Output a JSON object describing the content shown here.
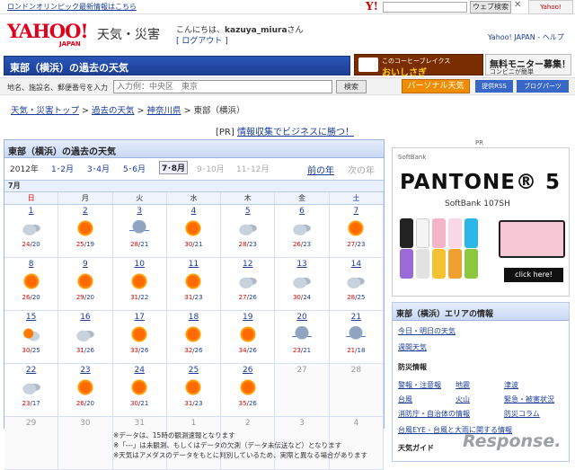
{
  "topbar": {
    "olympic_link": "ロンドンオリンピック最新情報はこちら",
    "yahoo_mini": "Y!",
    "search_button": "ウェブ検索",
    "close": "✕",
    "badge": "Yahoo!"
  },
  "header": {
    "logo": "YAHOO!",
    "logo_sub": "JAPAN",
    "service": "天気・災害",
    "greeting_prefix": "こんにちは、",
    "username": "kazuya_miura",
    "greeting_suffix": "さん",
    "logout": "[ ログアウト ]",
    "links": "Yahoo! JAPAN - ヘルプ"
  },
  "bluebar": {
    "title": "東部（横浜）の過去の天気"
  },
  "ads": {
    "coffee_line1": "このコーヒーブレイクス",
    "coffee_line2": "おいしさぎ",
    "monitor_line1": "無料モニター募集！",
    "monitor_line2": "コンビニが簡単"
  },
  "searchrow": {
    "label": "地名、施設名、郵便番号を入力",
    "placeholder": "入力例：中央区　東京",
    "button": "検索",
    "personal": "パーソナル天気",
    "rss": "提供RSS",
    "blog": "ブログパーツ"
  },
  "breadcrumb": {
    "items": [
      "天気・災害トップ",
      "過去の天気",
      "神奈川県"
    ],
    "current": "東部（横浜）",
    "sep": " > "
  },
  "pr": {
    "tag": "[PR]",
    "link": "情報収集でビジネスに勝つ！"
  },
  "main": {
    "title": "東部（横浜）の過去の天気",
    "year": "2012年",
    "months": [
      {
        "label": "1･2月",
        "state": "link"
      },
      {
        "label": "3･4月",
        "state": "link"
      },
      {
        "label": "5･6月",
        "state": "link"
      },
      {
        "label": "7･8月",
        "state": "selected"
      },
      {
        "label": "9･10月",
        "state": "disabled"
      },
      {
        "label": "11･12月",
        "state": "disabled"
      }
    ],
    "prev_year": "前の年",
    "next_year": "次の年",
    "calendar_month": "7月",
    "weekdays": [
      "日",
      "月",
      "火",
      "水",
      "木",
      "金",
      "土"
    ],
    "weeks": [
      [
        {
          "day": "1",
          "icon": "cloudy",
          "hi": "24",
          "lo": "20"
        },
        {
          "day": "2",
          "icon": "sunny",
          "hi": "25",
          "lo": "19"
        },
        {
          "day": "3",
          "icon": "rain",
          "hi": "28",
          "lo": "21"
        },
        {
          "day": "4",
          "icon": "sunny",
          "hi": "30",
          "lo": "21"
        },
        {
          "day": "5",
          "icon": "cloudy",
          "hi": "28",
          "lo": "23"
        },
        {
          "day": "6",
          "icon": "cloudy",
          "hi": "26",
          "lo": "23"
        },
        {
          "day": "7",
          "icon": "sunny",
          "hi": "27",
          "lo": "23"
        }
      ],
      [
        {
          "day": "8",
          "icon": "sunny",
          "hi": "26",
          "lo": "20"
        },
        {
          "day": "9",
          "icon": "sunny",
          "hi": "29",
          "lo": "20"
        },
        {
          "day": "10",
          "icon": "sunny",
          "hi": "31",
          "lo": "22"
        },
        {
          "day": "11",
          "icon": "sunny",
          "hi": "31",
          "lo": "23"
        },
        {
          "day": "12",
          "icon": "cloudy",
          "hi": "27",
          "lo": "26"
        },
        {
          "day": "13",
          "icon": "cloudy",
          "hi": "30",
          "lo": "24"
        },
        {
          "day": "14",
          "icon": "cloudy",
          "hi": "28",
          "lo": "25"
        }
      ],
      [
        {
          "day": "15",
          "icon": "sunnycloud",
          "hi": "30",
          "lo": "25"
        },
        {
          "day": "16",
          "icon": "cloudy",
          "hi": "31",
          "lo": "26"
        },
        {
          "day": "17",
          "icon": "sunny",
          "hi": "33",
          "lo": "26"
        },
        {
          "day": "18",
          "icon": "sunny",
          "hi": "32",
          "lo": "26"
        },
        {
          "day": "19",
          "icon": "sunny",
          "hi": "34",
          "lo": "26"
        },
        {
          "day": "20",
          "icon": "rain",
          "hi": "23",
          "lo": "21"
        },
        {
          "day": "21",
          "icon": "rain",
          "hi": "21",
          "lo": "18"
        }
      ],
      [
        {
          "day": "22",
          "icon": "cloudy",
          "hi": "23",
          "lo": "17"
        },
        {
          "day": "23",
          "icon": "sunny",
          "hi": "26",
          "lo": "20"
        },
        {
          "day": "24",
          "icon": "sunny",
          "hi": "30",
          "lo": "21"
        },
        {
          "day": "25",
          "icon": "sunny",
          "hi": "31",
          "lo": "23"
        },
        {
          "day": "26",
          "icon": "sunny",
          "hi": "35",
          "lo": "26"
        },
        {
          "day": "27",
          "icon": "",
          "hi": "",
          "lo": ""
        },
        {
          "day": "28",
          "icon": "",
          "hi": "",
          "lo": ""
        }
      ],
      [
        {
          "day": "29",
          "icon": "",
          "hi": "",
          "lo": ""
        },
        {
          "day": "30",
          "icon": "",
          "hi": "",
          "lo": ""
        },
        {
          "day": "31",
          "icon": "",
          "hi": "",
          "lo": ""
        },
        {
          "day": "1",
          "icon": "",
          "hi": "",
          "lo": ""
        },
        {
          "day": "2",
          "icon": "",
          "hi": "",
          "lo": ""
        },
        {
          "day": "3",
          "icon": "",
          "hi": "",
          "lo": ""
        },
        {
          "day": "4",
          "icon": "",
          "hi": "",
          "lo": ""
        }
      ]
    ],
    "notes": [
      "※データは、15時の観測速報となります",
      "※「---」は未観測、もしくはデータの欠測（データ未伝送など）となります",
      "※天気はアメダスのデータをもとに判別しているため、実際と異なる場合があります"
    ]
  },
  "right": {
    "pr": "PR",
    "softbank": "SoftBank",
    "pantone": "PANTONE® 5",
    "model": "SoftBank 107SH",
    "click": "click here!",
    "area_title": "東部（横浜）エリアの情報",
    "links_top": [
      "今日・明日の天気",
      "週間天気"
    ],
    "bosai_title": "防災情報",
    "bosai_links": [
      "警報・注意報",
      "地震",
      "津波",
      "台風",
      "火山",
      "緊急・被害状況",
      "消防庁・自治体の情報",
      "",
      "防災コラム"
    ],
    "typhoon": "台風EYE - 台風と大雨に関する情報",
    "guide_title": "天気ガイド"
  },
  "watermark": "Response."
}
